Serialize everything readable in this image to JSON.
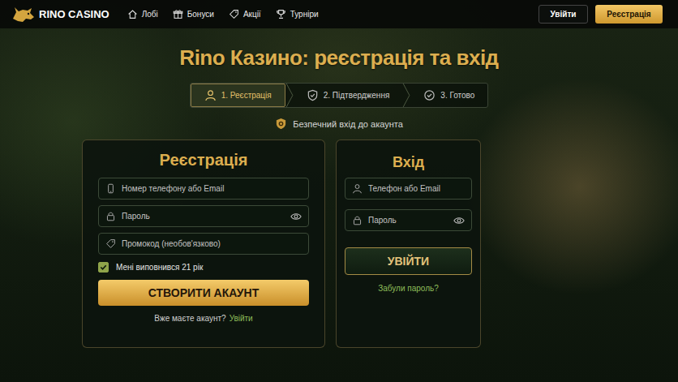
{
  "header": {
    "logo": "RINO CASINO",
    "nav": [
      {
        "label": "Лобі"
      },
      {
        "label": "Бонуси"
      },
      {
        "label": "Акції"
      },
      {
        "label": "Турніри"
      }
    ],
    "login_button": "Увійти",
    "register_button": "Реєстрація"
  },
  "title": "Rino Казино: реєстрація та вхід",
  "steps": [
    {
      "label": "1. Реєстрація",
      "selected": true
    },
    {
      "label": "2. Підтвердження",
      "selected": false
    },
    {
      "label": "3. Готово",
      "selected": false
    }
  ],
  "secure_note": "Безпечний вхід до акаунта",
  "register": {
    "title": "Реєстрація",
    "fields": [
      {
        "kind": "contact",
        "placeholder": "Номер телефону або Email"
      },
      {
        "kind": "password",
        "placeholder": "Пароль"
      },
      {
        "kind": "promo",
        "placeholder": "Промокод (необов'язково)"
      }
    ],
    "age_check": {
      "label": "Мені виповнився 21 рік",
      "checked": true
    },
    "submit": "СТВОРИТИ АКАУНТ",
    "footer_text": "Вже маєте акаунт?",
    "footer_link": "Увійти"
  },
  "login": {
    "title": "Вхід",
    "fields": [
      {
        "kind": "contact",
        "placeholder": "Телефон або Email"
      },
      {
        "kind": "password",
        "placeholder": "Пароль"
      }
    ],
    "submit": "УВІЙТИ",
    "forgot": "Забули пароль?"
  }
}
